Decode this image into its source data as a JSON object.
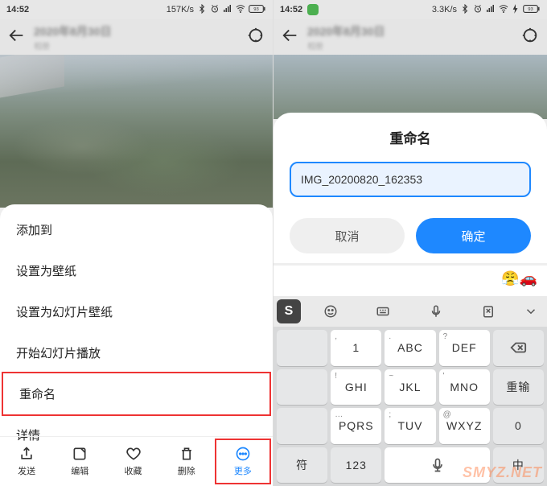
{
  "status": {
    "time": "14:52",
    "speed_left": "157K/s",
    "speed_right": "3.3K/s",
    "bt": "ⵣ",
    "alarm": "⏰",
    "sig": "📶",
    "wifi": "✓",
    "batt": "93"
  },
  "header": {
    "title_blur": "2020年8月30日",
    "subtitle_blur": "相册"
  },
  "left_menu": {
    "items": [
      "添加到",
      "设置为壁纸",
      "设置为幻灯片壁纸",
      "开始幻灯片播放",
      "重命名",
      "详情"
    ]
  },
  "left_toolbar": {
    "send": "发送",
    "edit": "编辑",
    "fav": "收藏",
    "del": "删除",
    "more": "更多"
  },
  "dialog": {
    "title": "重命名",
    "input_value": "IMG_20200820_162353",
    "cancel": "取消",
    "confirm": "确定"
  },
  "keyboard": {
    "keys": [
      {
        "sym": ",",
        "main": "1"
      },
      {
        "sym": ".",
        "main": "ABC"
      },
      {
        "sym": "?",
        "main": "DEF"
      },
      {
        "main": "⌫",
        "fn": true
      },
      {
        "sym": "!",
        "main": "GHI"
      },
      {
        "sym": "~",
        "main": "JKL"
      },
      {
        "sym": "'",
        "main": "MNO"
      },
      {
        "main": "重输",
        "fn": true
      },
      {
        "sym": "…",
        "main": "PQRS"
      },
      {
        "sym": ";",
        "main": "TUV"
      },
      {
        "sym": "@",
        "main": "WXYZ"
      },
      {
        "main": "0",
        "fn": true
      },
      {
        "main": "符",
        "fn": true
      },
      {
        "main": "123",
        "fn": true
      },
      {
        "main": "space",
        "space": true
      },
      {
        "main": "中",
        "fn": true,
        "half": true
      }
    ],
    "suggest_emoji": "😤🚗"
  },
  "watermark": "SMYZ.NET"
}
